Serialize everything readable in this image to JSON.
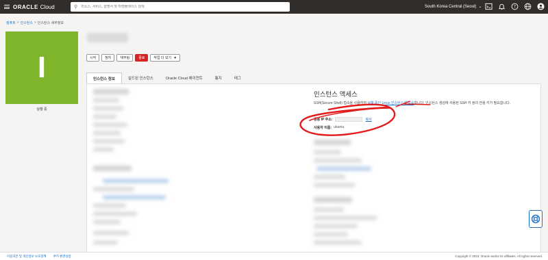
{
  "header": {
    "brand_oracle": "ORACLE",
    "brand_cloud": "Cloud",
    "search_placeholder": "리소스, 서비스, 설명서 및 마켓플레이스 검색",
    "region": "South Korea Central (Seoul)",
    "icons": [
      "menu-icon",
      "search-icon",
      "code-editor-icon",
      "bell-icon",
      "help-icon",
      "globe-icon",
      "user-icon"
    ]
  },
  "breadcrumb": {
    "compute": "컴퓨트",
    "instances": "인스턴스",
    "current": "인스턴스 세부정보"
  },
  "status": {
    "letter": "I",
    "label": "실행 중",
    "color": "#7fb52a"
  },
  "actions": {
    "start": "시작",
    "stop": "정지",
    "reboot": "재부팅",
    "terminate": "종료",
    "more": "작업 더 보기"
  },
  "tabs": [
    {
      "label": "인스턴스 정보"
    },
    {
      "label": "실드된 인스턴스"
    },
    {
      "label": "Oracle Cloud 에이전트"
    },
    {
      "label": "통지"
    },
    {
      "label": "태그"
    }
  ],
  "access": {
    "title": "인스턴스 액세스",
    "desc_prefix": "SSH(Secure Shell) 접속을 사용하여 ",
    "desc_link": "실행 중인 Linux 인스턴스에 접속",
    "desc_suffix": "합니다. 인스턴스 생성에 사용된 SSH 키 쌍의 전용 키가 필요합니다.",
    "ip_label": "공용 IP 주소:",
    "copy": "복사",
    "user_label": "사용자 이름:",
    "user_value": "ubuntu"
  },
  "footer": {
    "terms": "이용약관 및 개인정보 보호정책",
    "cookies": "쿠키 환경설정",
    "copyright": "Copyright © 2023, Oracle and/or its affiliates. All rights reserved."
  },
  "colors": {
    "topbar": "#312d2a",
    "accent": "#1b6ec2",
    "danger": "#d42424",
    "annotation": "#e21b1b"
  }
}
